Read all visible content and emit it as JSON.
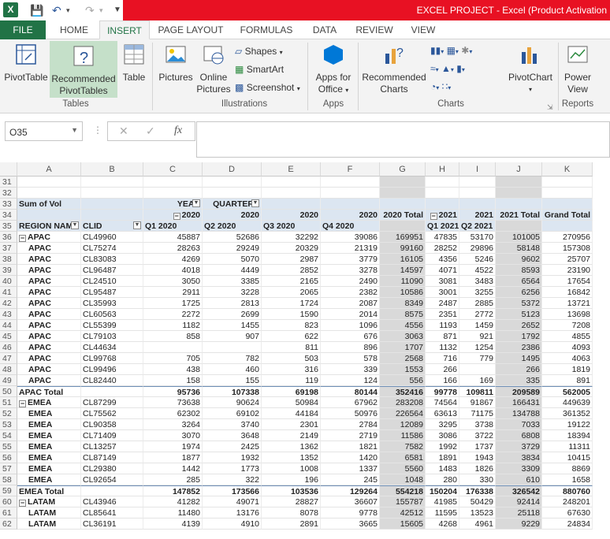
{
  "app": {
    "icon_letter": "X",
    "title": "EXCEL PROJECT -  Excel (Product Activation"
  },
  "tabs": [
    "FILE",
    "HOME",
    "INSERT",
    "PAGE LAYOUT",
    "FORMULAS",
    "DATA",
    "REVIEW",
    "VIEW"
  ],
  "active_tab": "INSERT",
  "ribbon": {
    "pivottable": "PivotTable",
    "rec_pivot1": "Recommended",
    "rec_pivot2": "PivotTables",
    "table": "Table",
    "pictures": "Pictures",
    "online1": "Online",
    "online2": "Pictures",
    "shapes": "Shapes",
    "smartart": "SmartArt",
    "screenshot": "Screenshot",
    "apps1": "Apps for",
    "apps2": "Office",
    "rec_charts1": "Recommended",
    "rec_charts2": "Charts",
    "pivotchart": "PivotChart",
    "power1": "Power",
    "power2": "View",
    "groups": {
      "tables": "Tables",
      "illustrations": "Illustrations",
      "apps": "Apps",
      "charts": "Charts",
      "reports": "Reports"
    }
  },
  "formula_bar": {
    "name_box": "O35",
    "fx": "fx",
    "value": ""
  },
  "columns": [
    "A",
    "B",
    "C",
    "D",
    "E",
    "F",
    "G",
    "H",
    "I",
    "J",
    "K"
  ],
  "rows": [
    {
      "n": "31",
      "cells": [
        "",
        "",
        "",
        "",
        "",
        "",
        "",
        "",
        "",
        "",
        ""
      ]
    },
    {
      "n": "32",
      "cells": [
        "",
        "",
        "",
        "",
        "",
        "",
        "",
        "",
        "",
        "",
        ""
      ]
    },
    {
      "n": "33",
      "cells": [
        "Sum of Vol",
        "",
        "YEAR",
        "QUARTERS",
        "",
        "",
        "",
        "",
        "",
        "",
        ""
      ],
      "hdr": true
    },
    {
      "n": "34",
      "cells": [
        "",
        "",
        "2020",
        "2020",
        "2020",
        "2020",
        "2020 Total",
        "2021",
        "2021",
        "2021 Total",
        "Grand Total"
      ],
      "hdr": true
    },
    {
      "n": "35",
      "cells": [
        "REGION NAME",
        "CLID",
        "Q1 2020",
        "Q2 2020",
        "Q3 2020",
        "Q4 2020",
        "",
        "Q1 2021",
        "Q2 2021",
        "",
        ""
      ],
      "hdr": true
    },
    {
      "n": "36",
      "cells": [
        "APAC",
        "CL49960",
        "45887",
        "52686",
        "32292",
        "39086",
        "169951",
        "47835",
        "53170",
        "101005",
        "270956"
      ],
      "first": true
    },
    {
      "n": "37",
      "cells": [
        "APAC",
        "CL75274",
        "28263",
        "29249",
        "20329",
        "21319",
        "99160",
        "28252",
        "29896",
        "58148",
        "157308"
      ]
    },
    {
      "n": "38",
      "cells": [
        "APAC",
        "CL83083",
        "4269",
        "5070",
        "2987",
        "3779",
        "16105",
        "4356",
        "5246",
        "9602",
        "25707"
      ]
    },
    {
      "n": "39",
      "cells": [
        "APAC",
        "CL96487",
        "4018",
        "4449",
        "2852",
        "3278",
        "14597",
        "4071",
        "4522",
        "8593",
        "23190"
      ]
    },
    {
      "n": "40",
      "cells": [
        "APAC",
        "CL24510",
        "3050",
        "3385",
        "2165",
        "2490",
        "11090",
        "3081",
        "3483",
        "6564",
        "17654"
      ]
    },
    {
      "n": "41",
      "cells": [
        "APAC",
        "CL95487",
        "2911",
        "3228",
        "2065",
        "2382",
        "10586",
        "3001",
        "3255",
        "6256",
        "16842"
      ]
    },
    {
      "n": "42",
      "cells": [
        "APAC",
        "CL35993",
        "1725",
        "2813",
        "1724",
        "2087",
        "8349",
        "2487",
        "2885",
        "5372",
        "13721"
      ]
    },
    {
      "n": "43",
      "cells": [
        "APAC",
        "CL60563",
        "2272",
        "2699",
        "1590",
        "2014",
        "8575",
        "2351",
        "2772",
        "5123",
        "13698"
      ]
    },
    {
      "n": "44",
      "cells": [
        "APAC",
        "CL55399",
        "1182",
        "1455",
        "823",
        "1096",
        "4556",
        "1193",
        "1459",
        "2652",
        "7208"
      ]
    },
    {
      "n": "45",
      "cells": [
        "APAC",
        "CL79103",
        "858",
        "907",
        "622",
        "676",
        "3063",
        "871",
        "921",
        "1792",
        "4855"
      ]
    },
    {
      "n": "46",
      "cells": [
        "APAC",
        "CL44634",
        "",
        "",
        "811",
        "896",
        "1707",
        "1132",
        "1254",
        "2386",
        "4093"
      ]
    },
    {
      "n": "47",
      "cells": [
        "APAC",
        "CL99768",
        "705",
        "782",
        "503",
        "578",
        "2568",
        "716",
        "779",
        "1495",
        "4063"
      ]
    },
    {
      "n": "48",
      "cells": [
        "APAC",
        "CL99496",
        "438",
        "460",
        "316",
        "339",
        "1553",
        "266",
        "",
        "266",
        "1819"
      ]
    },
    {
      "n": "49",
      "cells": [
        "APAC",
        "CL82440",
        "158",
        "155",
        "119",
        "124",
        "556",
        "166",
        "169",
        "335",
        "891"
      ]
    },
    {
      "n": "50",
      "cells": [
        "APAC Total",
        "",
        "95736",
        "107338",
        "69198",
        "80144",
        "352416",
        "99778",
        "109811",
        "209589",
        "562005"
      ],
      "total": true
    },
    {
      "n": "51",
      "cells": [
        "EMEA",
        "CL87299",
        "73638",
        "90624",
        "50984",
        "67962",
        "283208",
        "74564",
        "91867",
        "166431",
        "449639"
      ],
      "first": true
    },
    {
      "n": "52",
      "cells": [
        "EMEA",
        "CL75562",
        "62302",
        "69102",
        "44184",
        "50976",
        "226564",
        "63613",
        "71175",
        "134788",
        "361352"
      ]
    },
    {
      "n": "53",
      "cells": [
        "EMEA",
        "CL90358",
        "3264",
        "3740",
        "2301",
        "2784",
        "12089",
        "3295",
        "3738",
        "7033",
        "19122"
      ]
    },
    {
      "n": "54",
      "cells": [
        "EMEA",
        "CL71409",
        "3070",
        "3648",
        "2149",
        "2719",
        "11586",
        "3086",
        "3722",
        "6808",
        "18394"
      ]
    },
    {
      "n": "55",
      "cells": [
        "EMEA",
        "CL13257",
        "1974",
        "2425",
        "1362",
        "1821",
        "7582",
        "1992",
        "1737",
        "3729",
        "11311"
      ]
    },
    {
      "n": "56",
      "cells": [
        "EMEA",
        "CL87149",
        "1877",
        "1932",
        "1352",
        "1420",
        "6581",
        "1891",
        "1943",
        "3834",
        "10415"
      ]
    },
    {
      "n": "57",
      "cells": [
        "EMEA",
        "CL29380",
        "1442",
        "1773",
        "1008",
        "1337",
        "5560",
        "1483",
        "1826",
        "3309",
        "8869"
      ]
    },
    {
      "n": "58",
      "cells": [
        "EMEA",
        "CL92654",
        "285",
        "322",
        "196",
        "245",
        "1048",
        "280",
        "330",
        "610",
        "1658"
      ]
    },
    {
      "n": "59",
      "cells": [
        "EMEA Total",
        "",
        "147852",
        "173566",
        "103536",
        "129264",
        "554218",
        "150204",
        "176338",
        "326542",
        "880760"
      ],
      "total": true
    },
    {
      "n": "60",
      "cells": [
        "LATAM",
        "CL43946",
        "41282",
        "49071",
        "28827",
        "36607",
        "155787",
        "41985",
        "50429",
        "92414",
        "248201"
      ],
      "first": true
    },
    {
      "n": "61",
      "cells": [
        "LATAM",
        "CL85641",
        "11480",
        "13176",
        "8078",
        "9778",
        "42512",
        "11595",
        "13523",
        "25118",
        "67630"
      ]
    },
    {
      "n": "62",
      "cells": [
        "LATAM",
        "CL36191",
        "4139",
        "4910",
        "2891",
        "3665",
        "15605",
        "4268",
        "4961",
        "9229",
        "24834"
      ]
    }
  ]
}
